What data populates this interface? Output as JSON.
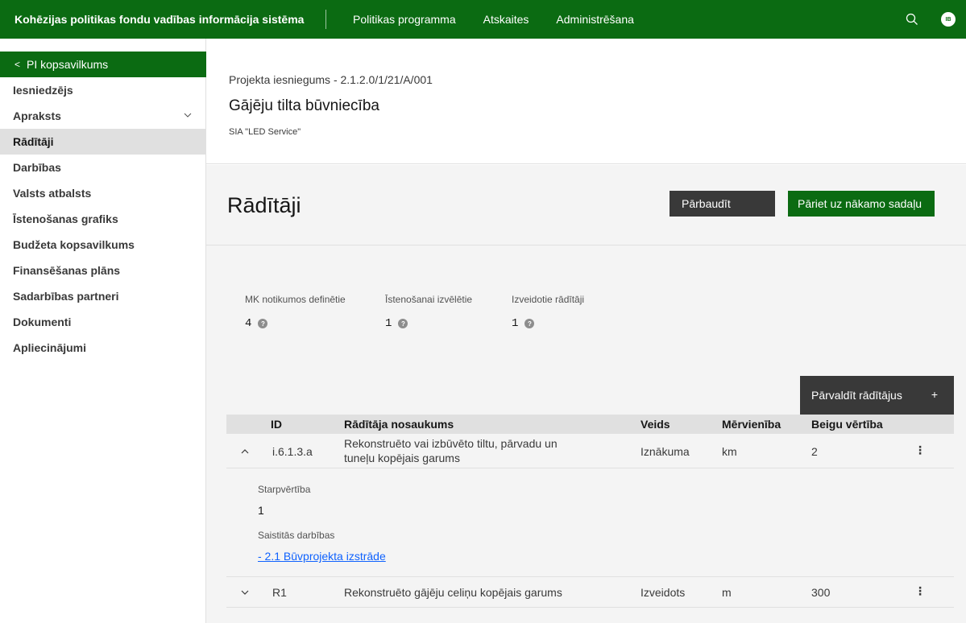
{
  "topbar": {
    "brand": "Kohēzijas politikas fondu vadības informācija sistēma",
    "nav": [
      "Politikas programma",
      "Atskaites",
      "Administrēšana"
    ],
    "avatar": "IB"
  },
  "sidebar": {
    "back_label": "PI kopsavilkums",
    "items": [
      {
        "label": "Iesniedzējs"
      },
      {
        "label": "Apraksts"
      },
      {
        "label": "Rādītāji"
      },
      {
        "label": "Darbības"
      },
      {
        "label": "Valsts atbalsts"
      },
      {
        "label": "Īstenošanas grafiks"
      },
      {
        "label": "Budžeta kopsavilkums"
      },
      {
        "label": "Finansēšanas plāns"
      },
      {
        "label": "Sadarbības partneri"
      },
      {
        "label": "Dokumenti"
      },
      {
        "label": "Apliecinājumi"
      }
    ]
  },
  "project": {
    "subtitle": "Projekta iesniegums - 2.1.2.0/1/21/A/001",
    "title": "Gājēju tilta būvniecība",
    "company": "SIA \"LED Service\""
  },
  "section": {
    "title": "Rādītāji",
    "check_button": "Pārbaudīt",
    "next_button": "Pāriet uz nākamo sadaļu"
  },
  "stats": [
    {
      "label": "MK notikumos definētie",
      "value": "4"
    },
    {
      "label": "Īstenošanai izvēlētie",
      "value": "1"
    },
    {
      "label": "Izveidotie rādītāji",
      "value": "1"
    }
  ],
  "table": {
    "manage_button": "Pārvaldīt rādītājus",
    "headers": {
      "id": "ID",
      "name": "Rādītāja nosaukums",
      "type": "Veids",
      "unit": "Mērvienība",
      "final": "Beigu vērtība"
    },
    "rows": [
      {
        "id": "i.6.1.3.a",
        "name_line1": "Rekonstruēto vai izbūvēto tiltu, pārvadu un",
        "name_line2": "tuneļu kopējais garums",
        "type": "Iznākuma",
        "unit": "km",
        "final": "2"
      },
      {
        "id": "R1",
        "name_line1": "Rekonstruēto gājēju celiņu kopējais garums",
        "type": "Izveidots",
        "unit": "m",
        "final": "300"
      }
    ],
    "expanded": {
      "intermediate_label": "Starpvērtība",
      "intermediate_value": "1",
      "linked_label": "Saistitās darbības",
      "linked_link": "- 2.1 Būvprojekta izstrāde"
    }
  }
}
